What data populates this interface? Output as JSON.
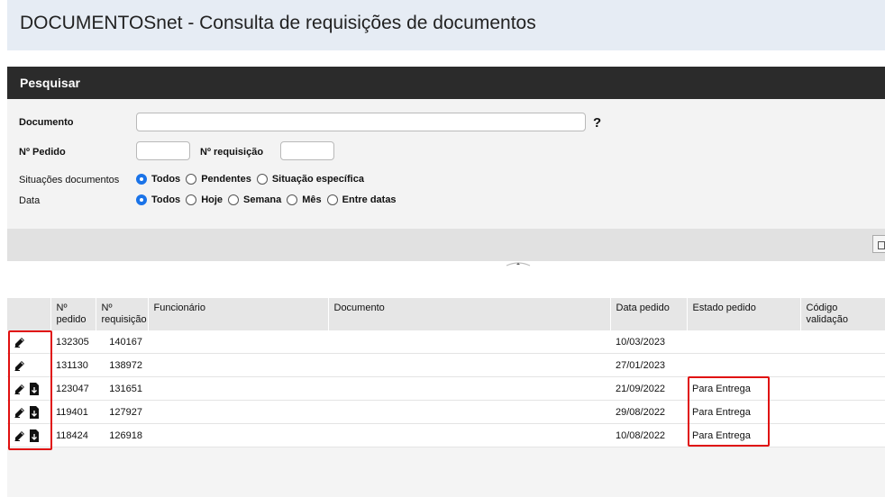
{
  "window": {
    "title": "DOCUMENTOSnet - Consulta de requisições de documentos"
  },
  "search_panel": {
    "header": "Pesquisar",
    "document_label": "Documento",
    "document_value": "",
    "help_symbol": "?",
    "order_label": "Nº Pedido",
    "order_value": "",
    "requisition_label": "Nº requisição",
    "requisition_value": "",
    "situation_label": "Situações documentos",
    "situation_options": [
      "Todos",
      "Pendentes",
      "Situação específica"
    ],
    "situation_selected": "Todos",
    "date_label": "Data",
    "date_options": [
      "Todos",
      "Hoje",
      "Semana",
      "Mês",
      "Entre datas"
    ],
    "date_selected": "Todos"
  },
  "table": {
    "headers": [
      "",
      "Nº pedido",
      "Nº requisição",
      "Funcionário",
      "Documento",
      "Data pedido",
      "Estado pedido",
      "Código validação"
    ],
    "rows": [
      {
        "actions": [
          "edit-icon"
        ],
        "pedido": "132305",
        "requisicao": "140167",
        "funcionario": "",
        "documento": "",
        "data": "10/03/2023",
        "estado": "",
        "codigo": ""
      },
      {
        "actions": [
          "edit-icon"
        ],
        "pedido": "131130",
        "requisicao": "138972",
        "funcionario": "",
        "documento": "",
        "data": "27/01/2023",
        "estado": "",
        "codigo": ""
      },
      {
        "actions": [
          "edit-icon",
          "download-icon"
        ],
        "pedido": "123047",
        "requisicao": "131651",
        "funcionario": "",
        "documento": "",
        "data": "21/09/2022",
        "estado": "Para Entrega",
        "codigo": ""
      },
      {
        "actions": [
          "edit-icon",
          "download-icon"
        ],
        "pedido": "119401",
        "requisicao": "127927",
        "funcionario": "",
        "documento": "",
        "data": "29/08/2022",
        "estado": "Para Entrega",
        "codigo": ""
      },
      {
        "actions": [
          "edit-icon",
          "download-icon"
        ],
        "pedido": "118424",
        "requisicao": "126918",
        "funcionario": "",
        "documento": "",
        "data": "10/08/2022",
        "estado": "Para Entrega",
        "codigo": ""
      }
    ]
  },
  "colors": {
    "header_dark": "#2b2b2b",
    "title_bg": "#e6ecf4",
    "radio_checked": "#1a73e8",
    "highlight_box": "#e01010"
  }
}
